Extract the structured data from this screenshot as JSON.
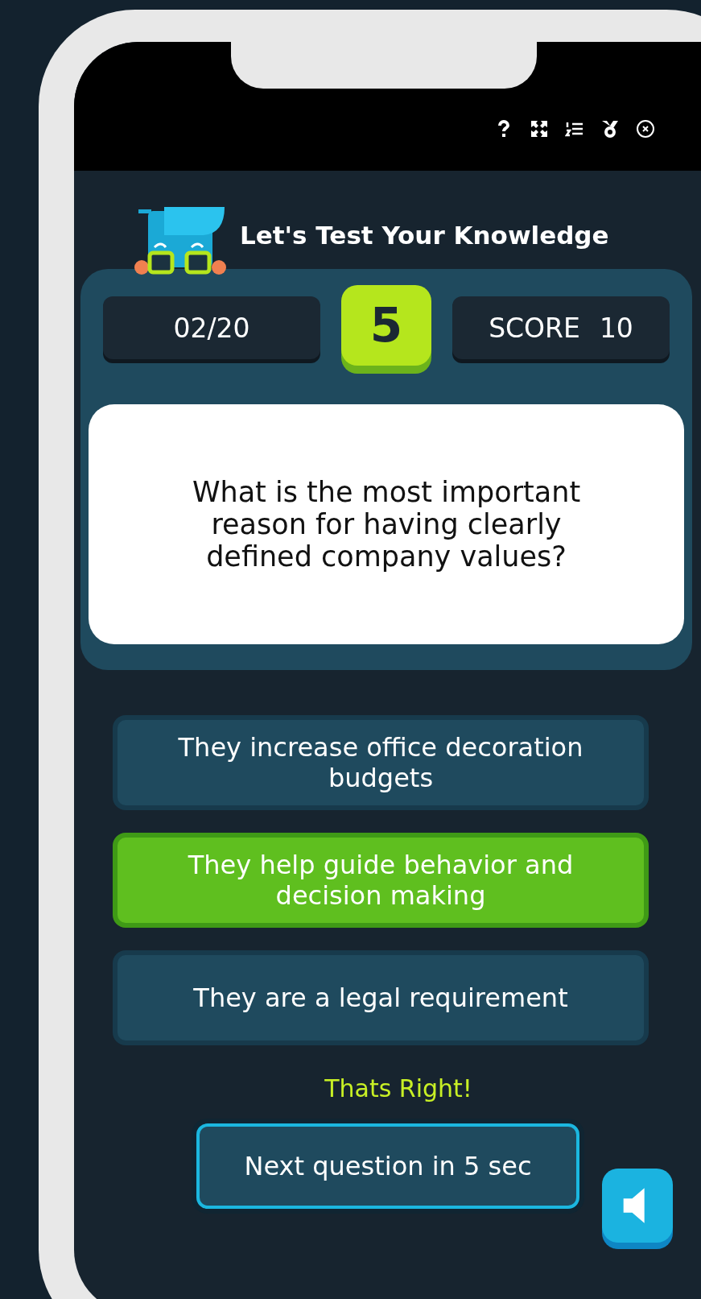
{
  "toolbar": {
    "icons": [
      {
        "kind": "help"
      },
      {
        "kind": "fullscreen"
      },
      {
        "kind": "list"
      },
      {
        "kind": "medal"
      },
      {
        "kind": "close"
      }
    ]
  },
  "header": {
    "title": "Let's Test Your Knowledge"
  },
  "stats": {
    "progress": "02/20",
    "timer": "5",
    "score_label": "SCORE",
    "score": "10"
  },
  "question": "What is the most important reason for having clearly defined company values?",
  "answers": [
    {
      "text": "They increase office decoration budgets",
      "selected": false
    },
    {
      "text": "They help guide behavior and decision making",
      "selected": true
    },
    {
      "text": "They are a legal requirement",
      "selected": false
    }
  ],
  "feedback": "Thats Right!",
  "next_button": "Next question in 5 sec",
  "sound": {
    "on": true
  }
}
